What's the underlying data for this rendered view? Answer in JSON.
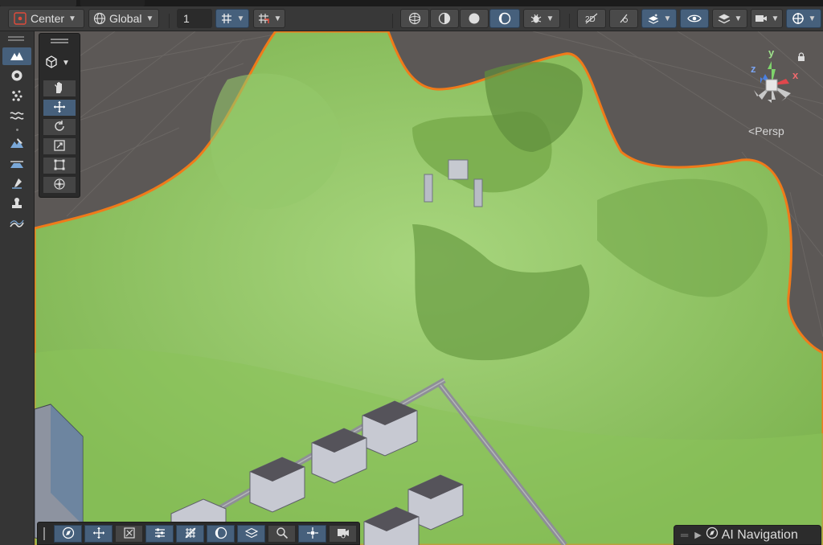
{
  "toolbar": {
    "pivot_mode": "Center",
    "pivot_rotation": "Global",
    "grid_size": "1"
  },
  "gizmo": {
    "axes": {
      "y": "y",
      "x": "x",
      "z": "z"
    },
    "projection_label": "Persp"
  },
  "overlays": {
    "ai_navigation_label": "AI Navigation"
  },
  "icons": {
    "toolbar_left": [
      "pivot-center-icon",
      "global-icon",
      "grid-snap-icon",
      "increment-snap-icon"
    ],
    "toolbar_right": [
      "wireframe-icon",
      "shaded-wire-icon",
      "shaded-icon",
      "lighting-icon",
      "bug-icon",
      "2d-icon",
      "light-toggle-icon",
      "fx-icon",
      "visibility-icon",
      "layers-icon",
      "camera-icon",
      "gizmos-icon"
    ],
    "terrain_tools": [
      "raise-terrain-icon",
      "paint-holes-icon",
      "paint-details-icon",
      "smooth-icon",
      "paint-texture-icon",
      "set-height-icon",
      "stamp-icon",
      "stamp-terrain-icon",
      "terrain-settings-icon"
    ],
    "scene_tools": [
      "view-tool-icon",
      "move-tool-icon",
      "rotate-tool-icon",
      "scale-tool-icon",
      "rect-tool-icon",
      "transform-tool-icon"
    ],
    "bottom_tools": [
      "navigation-icon",
      "move-icon",
      "build-icon",
      "settings-icon",
      "mesh-icon",
      "skybox-icon",
      "layers-icon",
      "search-icon",
      "pivot-icon",
      "camera-icon"
    ]
  },
  "colors": {
    "toolbar_bg": "#383838",
    "active_button": "#46607c",
    "terrain_green": "#8ec25f",
    "selection_outline": "#f07a1a",
    "axis_x": "#e0474c",
    "axis_y": "#7ed36b",
    "axis_z": "#4a7fe0"
  }
}
